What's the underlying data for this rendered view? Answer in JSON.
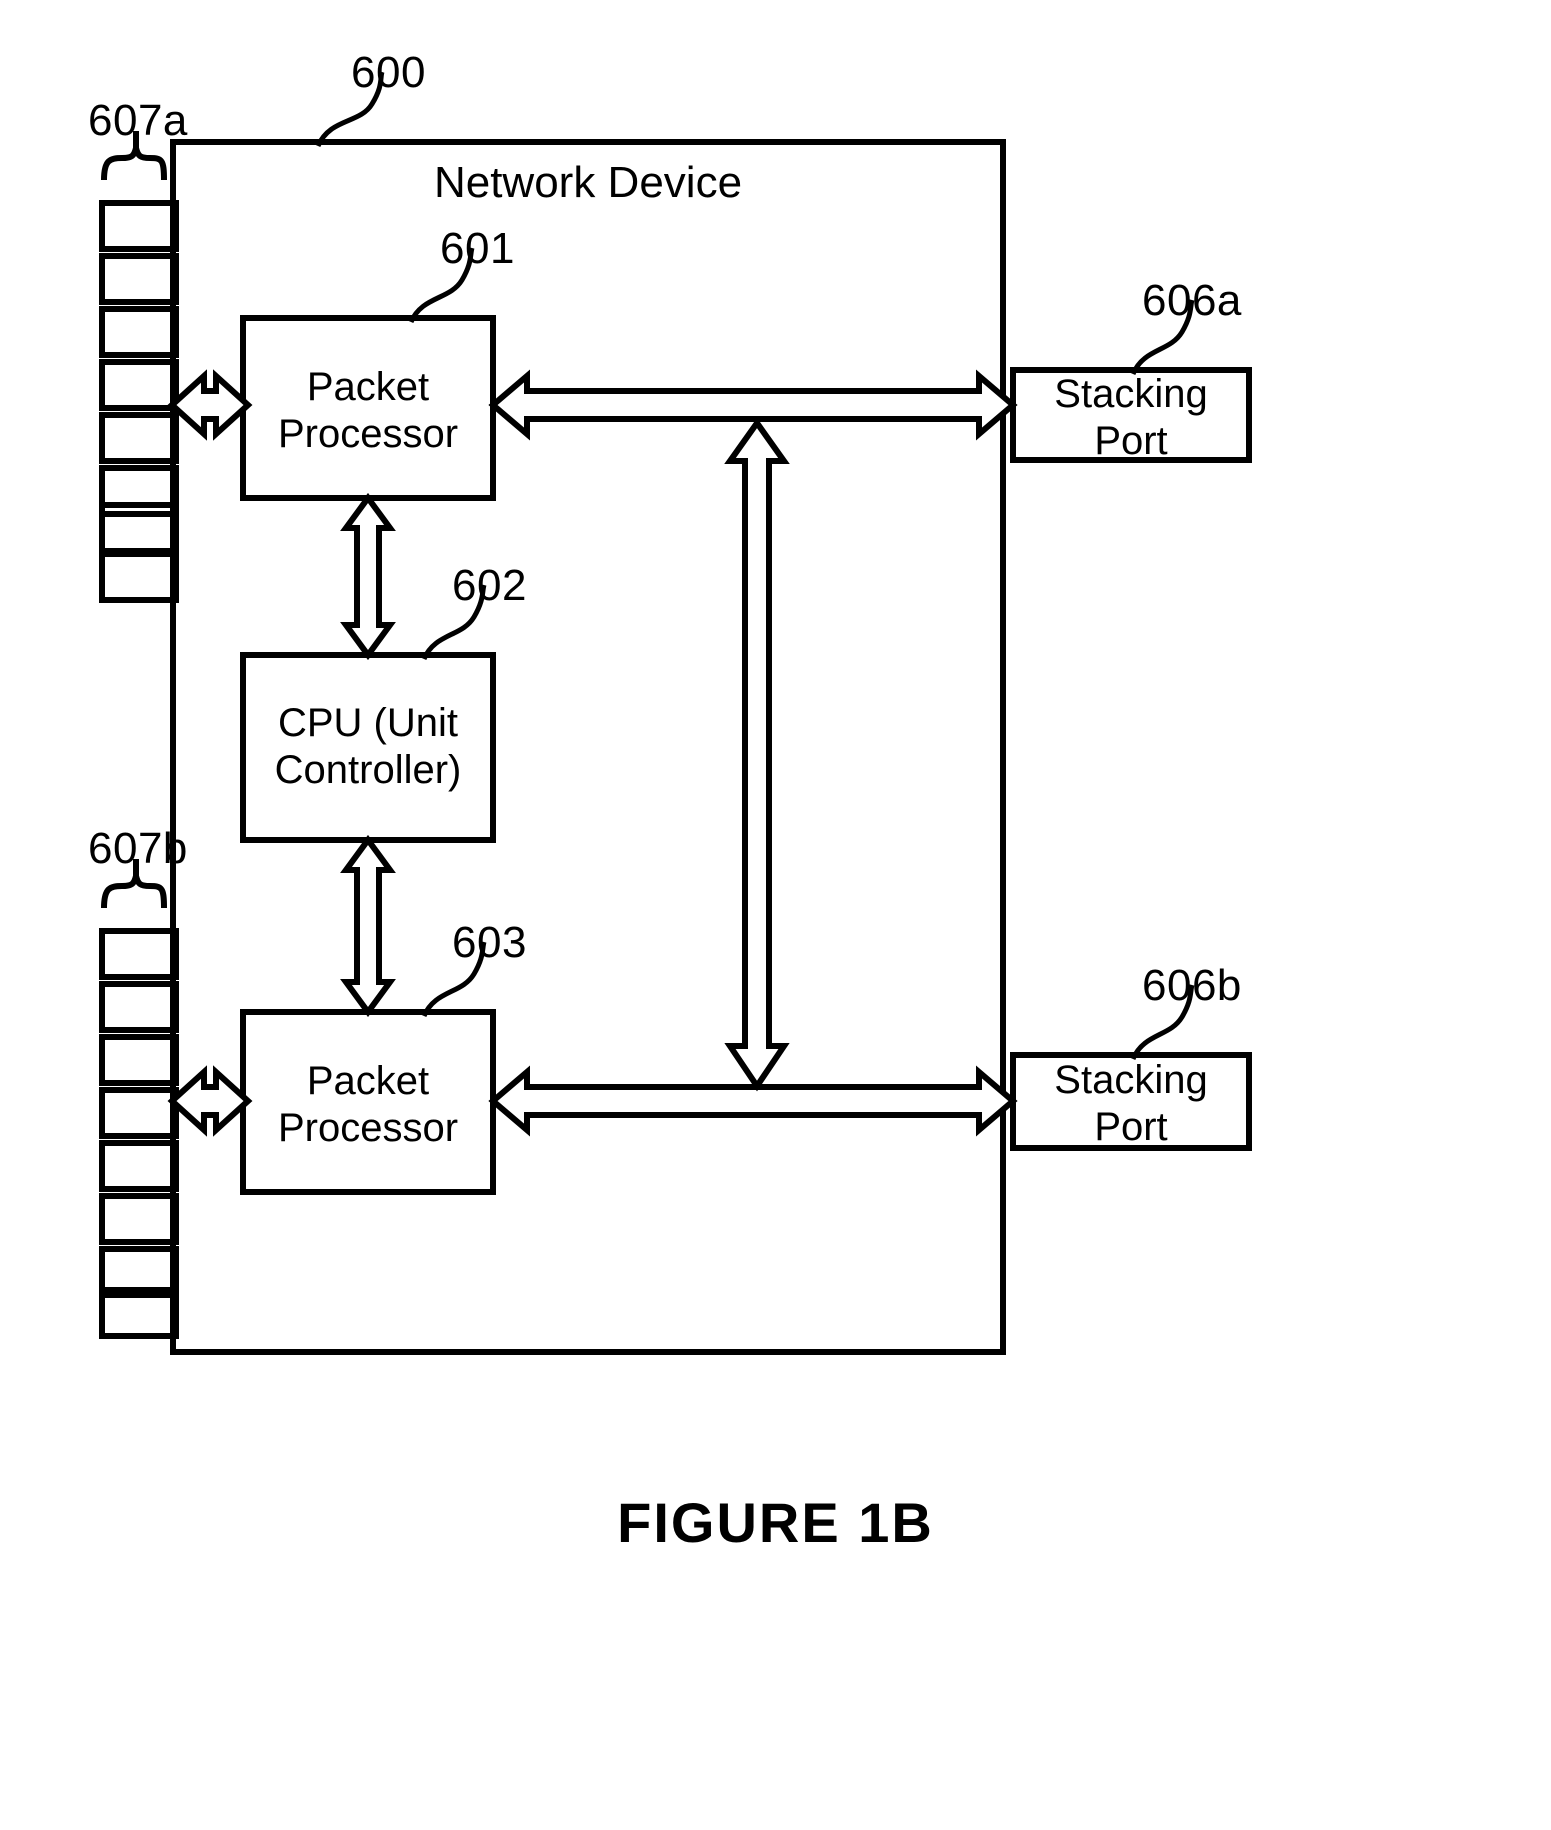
{
  "figure": {
    "caption": "FIGURE 1B",
    "title": "Network Device"
  },
  "diagram": {
    "type": "block-diagram",
    "device": {
      "ref": "600",
      "label": "Network Device"
    },
    "blocks": [
      {
        "ref": "601",
        "label": "Packet\nProcessor",
        "line1": "Packet",
        "line2": "Processor"
      },
      {
        "ref": "602",
        "label": "CPU (Unit\nController)",
        "line1": "CPU (Unit",
        "line2": "Controller)"
      },
      {
        "ref": "603",
        "label": "Packet\nProcessor",
        "line1": "Packet",
        "line2": "Processor"
      }
    ],
    "stacking_ports": [
      {
        "ref": "606a",
        "line1": "Stacking",
        "line2": "Port"
      },
      {
        "ref": "606b",
        "line1": "Stacking",
        "line2": "Port"
      }
    ],
    "port_groups": [
      {
        "ref": "607a",
        "count": 8
      },
      {
        "ref": "607b",
        "count": 8
      }
    ],
    "connections": [
      {
        "from": "607a",
        "to": "601",
        "style": "double-headed-outline-arrow"
      },
      {
        "from": "601",
        "to": "606a",
        "style": "double-headed-outline-arrow"
      },
      {
        "from": "601",
        "to": "602",
        "style": "double-headed-outline-arrow-vertical"
      },
      {
        "from": "602",
        "to": "603",
        "style": "double-headed-outline-arrow-vertical"
      },
      {
        "from": "607b",
        "to": "603",
        "style": "double-headed-outline-arrow"
      },
      {
        "from": "603",
        "to": "606b",
        "style": "double-headed-outline-arrow"
      },
      {
        "from": "601",
        "to": "603",
        "style": "double-headed-outline-arrow-vertical-bus"
      }
    ],
    "colors": {
      "stroke": "#000000",
      "background": "#ffffff"
    }
  }
}
